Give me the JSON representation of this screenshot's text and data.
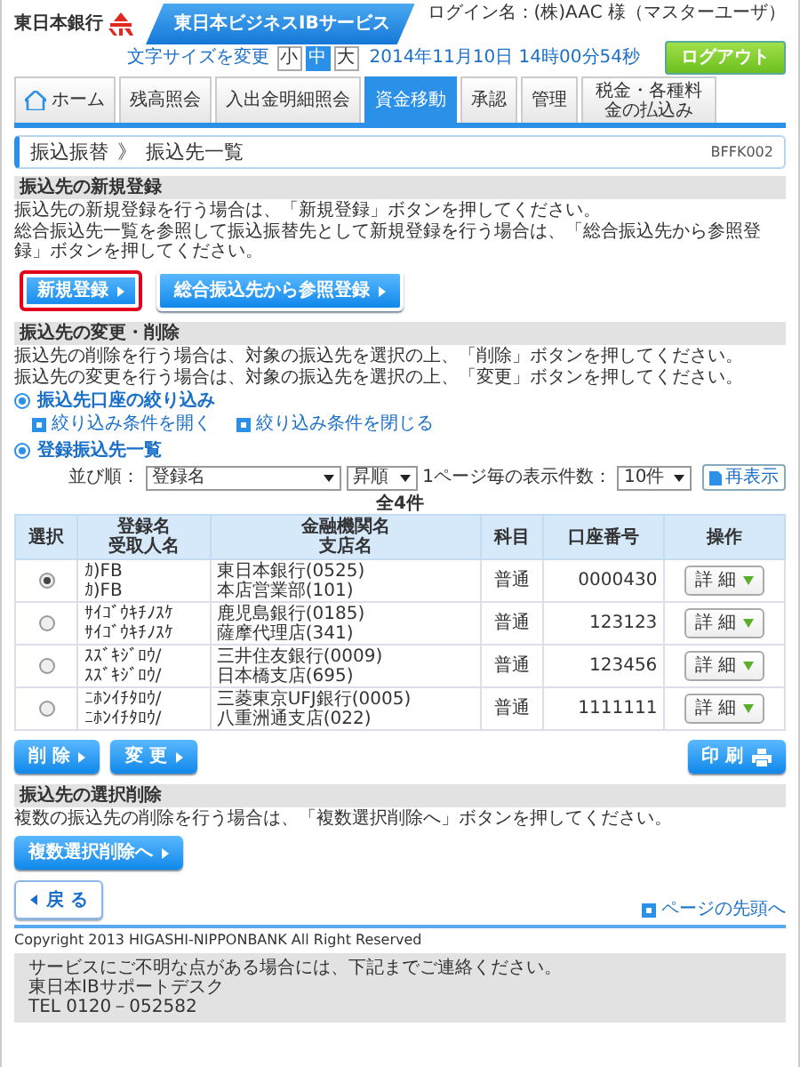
{
  "header": {
    "bank_name": "東日本銀行",
    "service_title": "東日本ビジネスIBサービス",
    "login_name": "ログイン名：(株)AAC 様（マスターユーザ）",
    "font_size_label": "文字サイズを変更",
    "font_sizes": [
      {
        "label": "小",
        "selected": false
      },
      {
        "label": "中",
        "selected": true
      },
      {
        "label": "大",
        "selected": false
      }
    ],
    "logout": "ログアウト",
    "datetime": "2014年11月10日 14時00分54秒"
  },
  "tabs": [
    {
      "label": "ホーム",
      "kind": "home",
      "selected": false
    },
    {
      "label": "残高照会",
      "kind": "text",
      "selected": false
    },
    {
      "label": "入出金明細照会",
      "kind": "text",
      "selected": false
    },
    {
      "label": "資金移動",
      "kind": "text",
      "selected": true
    },
    {
      "label": "承認",
      "kind": "text",
      "selected": false
    },
    {
      "label": "管理",
      "kind": "text",
      "selected": false
    },
    {
      "label": "税金・各種料金の払込み",
      "kind": "text",
      "selected": false
    }
  ],
  "breadcrumb": {
    "parent": "振込振替",
    "separator": "》",
    "current": "振込先一覧",
    "screen_id": "BFFK002"
  },
  "new_registration": {
    "heading": "振込先の新規登録",
    "descriptions": [
      "振込先の新規登録を行う場合は、「新規登録」ボタンを押してください。",
      "総合振込先一覧を参照して振込振替先として新規登録を行う場合は、「総合振込先から参照登録」ボタンを押してください。"
    ],
    "buttons": [
      {
        "label": "新規登録",
        "highlighted": true
      },
      {
        "label": "総合振込先から参照登録",
        "highlighted": false
      }
    ]
  },
  "change_delete": {
    "heading": "振込先の変更・削除",
    "descriptions": [
      "振込先の削除を行う場合は、対象の振込先を選択の上、「削除」ボタンを押してください。",
      "振込先の変更を行う場合は、対象の振込先を選択の上、「変更」ボタンを押してください。"
    ],
    "filter_heading": "振込先口座の絞り込み",
    "filter_links": [
      "絞り込み条件を開く",
      "絞り込み条件を閉じる"
    ],
    "list_heading": "登録振込先一覧",
    "sort_label": "並び順：",
    "sort_field": "登録名",
    "sort_order": "昇順",
    "per_page_label": "1ページ毎の表示件数：",
    "per_page": "10件",
    "refresh": "再表示",
    "total": "全4件"
  },
  "table": {
    "columns": [
      [
        "選択"
      ],
      [
        "登録名",
        "受取人名"
      ],
      [
        "金融機関名",
        "支店名"
      ],
      [
        "科目"
      ],
      [
        "口座番号"
      ],
      [
        "操作"
      ]
    ],
    "rows": [
      {
        "selected": true,
        "name": [
          "ｶ)FB",
          "ｶ)FB"
        ],
        "bank": [
          "東日本銀行(0525)",
          "本店営業部(101)"
        ],
        "subject": "普通",
        "account": "0000430",
        "action": "詳 細"
      },
      {
        "selected": false,
        "name": [
          "ｻｲｺﾞｳｷﾁﾉｽｹ",
          "ｻｲｺﾞｳｷﾁﾉｽｹ"
        ],
        "bank": [
          "鹿児島銀行(0185)",
          "薩摩代理店(341)"
        ],
        "subject": "普通",
        "account": "123123",
        "action": "詳 細"
      },
      {
        "selected": false,
        "name": [
          "ｽｽﾞｷｼﾞﾛｳ/",
          "ｽｽﾞｷｼﾞﾛｳ/"
        ],
        "bank": [
          "三井住友銀行(0009)",
          "日本橋支店(695)"
        ],
        "subject": "普通",
        "account": "123456",
        "action": "詳 細"
      },
      {
        "selected": false,
        "name": [
          "ﾆﾎﾝｲﾁﾀﾛｳ/",
          "ﾆﾎﾝｲﾁﾀﾛｳ/"
        ],
        "bank": [
          "三菱東京UFJ銀行(0005)",
          "八重洲通支店(022)"
        ],
        "subject": "普通",
        "account": "1111111",
        "action": "詳 細"
      }
    ]
  },
  "table_buttons": [
    "削 除",
    "変 更"
  ],
  "print_button": "印 刷",
  "bulk_delete": {
    "heading": "振込先の選択削除",
    "description": "複数の振込先の削除を行う場合は、「複数選択削除へ」ボタンを押してください。",
    "button": "複数選択削除へ"
  },
  "back_button": "戻 る",
  "page_top_link": "ページの先頭へ",
  "copyright": "Copyright 2013 HIGASHI-NIPPONBANK All Right Reserved",
  "support": [
    "サービスにご不明な点がある場合には、下記までご連絡ください。",
    "東日本IBサポートデスク",
    "TEL 0120－052582"
  ]
}
